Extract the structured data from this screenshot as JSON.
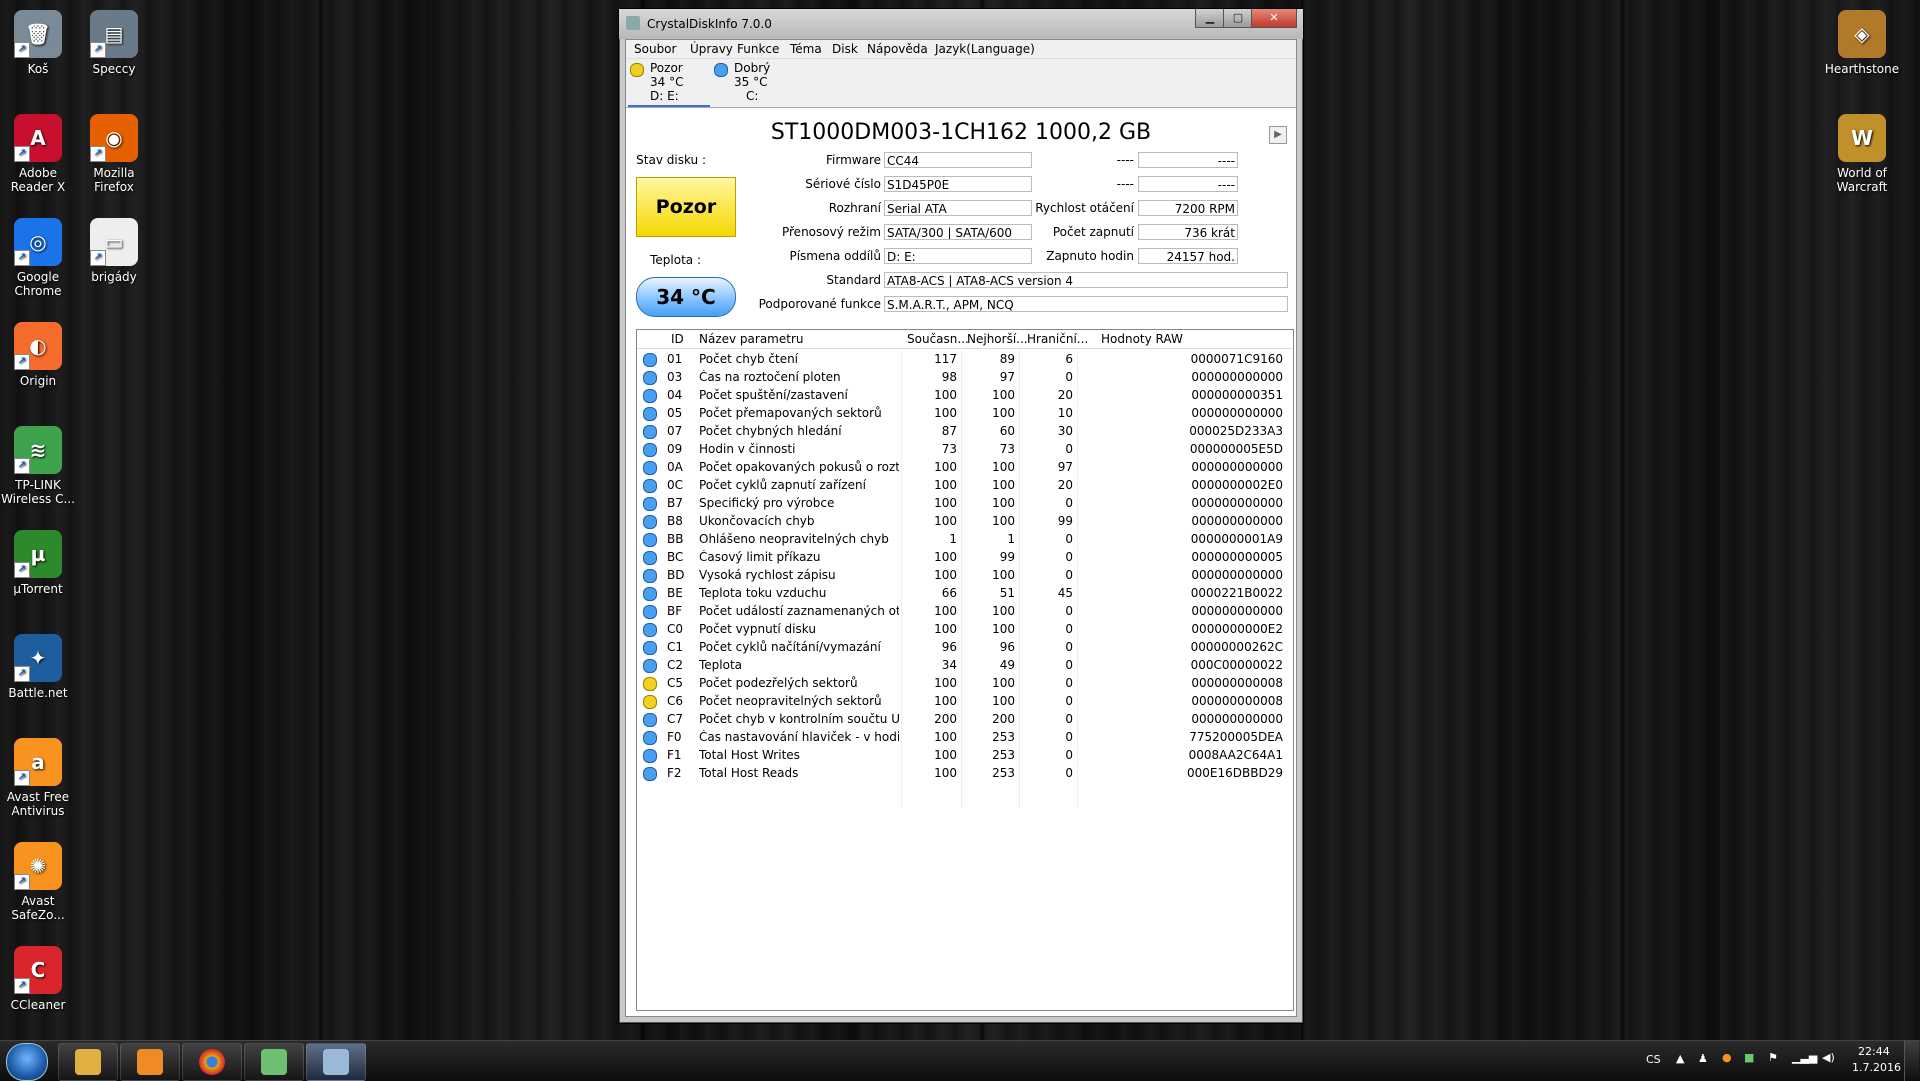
{
  "desktop_left": [
    {
      "label": "Koš",
      "color": "#7a8a96",
      "glyph": "🗑",
      "name": "recycle-bin-icon"
    },
    {
      "label": "Speccy",
      "color": "#6b7a88",
      "glyph": "▤",
      "name": "speccy-icon"
    },
    {
      "label": "Adobe\nReader X",
      "color": "#c8102e",
      "glyph": "A",
      "name": "adobe-reader-icon"
    },
    {
      "label": "Mozilla\nFirefox",
      "color": "#e66000",
      "glyph": "◉",
      "name": "firefox-icon"
    },
    {
      "label": "Google\nChrome",
      "color": "#1a73e8",
      "glyph": "◎",
      "name": "chrome-icon"
    },
    {
      "label": "brigády",
      "color": "#eeeeee",
      "glyph": "▭",
      "name": "document-icon"
    },
    {
      "label": "Origin",
      "color": "#f56c2d",
      "glyph": "◐",
      "name": "origin-icon"
    },
    {
      "label": "TP-LINK\nWireless C...",
      "color": "#3fa34d",
      "glyph": "≋",
      "name": "tplink-icon"
    },
    {
      "label": "µTorrent",
      "color": "#2c8a2c",
      "glyph": "µ",
      "name": "utorrent-icon"
    },
    {
      "label": "Battle.net",
      "color": "#1f5e9e",
      "glyph": "✦",
      "name": "battlenet-icon"
    },
    {
      "label": "Avast Free\nAntivirus",
      "color": "#f7931e",
      "glyph": "a",
      "name": "avast-icon"
    },
    {
      "label": "Avast\nSafeZo...",
      "color": "#f7931e",
      "glyph": "✺",
      "name": "avast-safezone-icon"
    },
    {
      "label": "CCleaner",
      "color": "#d8262c",
      "glyph": "C",
      "name": "ccleaner-icon"
    }
  ],
  "desktop_right": [
    {
      "label": "Hearthstone",
      "color": "#b07a2a",
      "glyph": "◈",
      "name": "hearthstone-icon"
    },
    {
      "label": "World of\nWarcraft",
      "color": "#c0902a",
      "glyph": "W",
      "name": "wow-icon"
    }
  ],
  "window": {
    "title": "CrystalDiskInfo 7.0.0",
    "menu": [
      "Soubor",
      "Úpravy",
      "Funkce",
      "Téma",
      "Disk",
      "Nápověda",
      "Jazyk(Language)"
    ],
    "disks": [
      {
        "status": "Pozor",
        "temp": "34 °C",
        "letters": "D: E:",
        "color": "#f0d020"
      },
      {
        "status": "Dobrý",
        "temp": "35 °C",
        "letters": "C:",
        "color": "#4aa0ee"
      }
    ],
    "model": "ST1000DM003-1CH162 1000,2 GB",
    "stav_label": "Stav disku :",
    "status_text": "Pozor",
    "teplota_label": "Teplota :",
    "temp_text": "34 °C",
    "fields": {
      "firmware_label": "Firmware",
      "firmware": "CC44",
      "serial_label": "Sériové číslo",
      "serial": "S1D45P0E",
      "iface_label": "Rozhraní",
      "iface": "Serial ATA",
      "mode_label": "Přenosový režim",
      "mode": "SATA/300 | SATA/600",
      "letters_label": "Písmena oddílů",
      "letters": "D: E:",
      "standard_label": "Standard",
      "standard": "ATA8-ACS | ATA8-ACS version 4",
      "features_label": "Podporované funkce",
      "features": "S.M.A.R.T., APM, NCQ",
      "r1_label": "----",
      "r1": "----",
      "r2_label": "----",
      "r2": "----",
      "rpm_label": "Rychlost otáčení",
      "rpm": "7200 RPM",
      "count_label": "Počet zapnutí",
      "count": "736 krát",
      "hours_label": "Zapnuto hodin",
      "hours": "24157 hod."
    },
    "table_headers": [
      "ID",
      "Název parametru",
      "Současn...",
      "Nejhorší...",
      "Hraniční...",
      "Hodnoty RAW"
    ],
    "rows": [
      {
        "id": "01",
        "name": "Počet chyb čtení",
        "cur": "117",
        "worst": "89",
        "thr": "6",
        "raw": "0000071C9160",
        "c": "#4aa0ee"
      },
      {
        "id": "03",
        "name": "Čas na roztočení ploten",
        "cur": "98",
        "worst": "97",
        "thr": "0",
        "raw": "000000000000",
        "c": "#4aa0ee"
      },
      {
        "id": "04",
        "name": "Počet spuštění/zastavení",
        "cur": "100",
        "worst": "100",
        "thr": "20",
        "raw": "000000000351",
        "c": "#4aa0ee"
      },
      {
        "id": "05",
        "name": "Počet přemapovaných sektorů",
        "cur": "100",
        "worst": "100",
        "thr": "10",
        "raw": "000000000000",
        "c": "#4aa0ee"
      },
      {
        "id": "07",
        "name": "Počet chybných hledání",
        "cur": "87",
        "worst": "60",
        "thr": "30",
        "raw": "000025D233A3",
        "c": "#4aa0ee"
      },
      {
        "id": "09",
        "name": "Hodin v činnosti",
        "cur": "73",
        "worst": "73",
        "thr": "0",
        "raw": "000000005E5D",
        "c": "#4aa0ee"
      },
      {
        "id": "0A",
        "name": "Počet opakovaných pokusů o roztočení p...",
        "cur": "100",
        "worst": "100",
        "thr": "97",
        "raw": "000000000000",
        "c": "#4aa0ee"
      },
      {
        "id": "0C",
        "name": "Počet cyklů zapnutí zařízení",
        "cur": "100",
        "worst": "100",
        "thr": "20",
        "raw": "0000000002E0",
        "c": "#4aa0ee"
      },
      {
        "id": "B7",
        "name": "Specifický pro výrobce",
        "cur": "100",
        "worst": "100",
        "thr": "0",
        "raw": "000000000000",
        "c": "#4aa0ee"
      },
      {
        "id": "B8",
        "name": "Ukončovacích chyb",
        "cur": "100",
        "worst": "100",
        "thr": "99",
        "raw": "000000000000",
        "c": "#4aa0ee"
      },
      {
        "id": "BB",
        "name": "Ohlášeno neopravitelných chyb",
        "cur": "1",
        "worst": "1",
        "thr": "0",
        "raw": "0000000001A9",
        "c": "#4aa0ee"
      },
      {
        "id": "BC",
        "name": "Časový limit příkazu",
        "cur": "100",
        "worst": "99",
        "thr": "0",
        "raw": "000000000005",
        "c": "#4aa0ee"
      },
      {
        "id": "BD",
        "name": "Vysoká rychlost zápisu",
        "cur": "100",
        "worst": "100",
        "thr": "0",
        "raw": "000000000000",
        "c": "#4aa0ee"
      },
      {
        "id": "BE",
        "name": "Teplota toku vzduchu",
        "cur": "66",
        "worst": "51",
        "thr": "45",
        "raw": "0000221B0022",
        "c": "#4aa0ee"
      },
      {
        "id": "BF",
        "name": "Počet událostí zaznamenaných otřesový...",
        "cur": "100",
        "worst": "100",
        "thr": "0",
        "raw": "000000000000",
        "c": "#4aa0ee"
      },
      {
        "id": "C0",
        "name": "Počet vypnutí disku",
        "cur": "100",
        "worst": "100",
        "thr": "0",
        "raw": "0000000000E2",
        "c": "#4aa0ee"
      },
      {
        "id": "C1",
        "name": "Počet cyklů načítání/vymazání",
        "cur": "96",
        "worst": "96",
        "thr": "0",
        "raw": "00000000262C",
        "c": "#4aa0ee"
      },
      {
        "id": "C2",
        "name": "Teplota",
        "cur": "34",
        "worst": "49",
        "thr": "0",
        "raw": "000C00000022",
        "c": "#4aa0ee"
      },
      {
        "id": "C5",
        "name": "Počet podezřelých sektorů",
        "cur": "100",
        "worst": "100",
        "thr": "0",
        "raw": "000000000008",
        "c": "#f0d020"
      },
      {
        "id": "C6",
        "name": "Počet neopravitelných sektorů",
        "cur": "100",
        "worst": "100",
        "thr": "0",
        "raw": "000000000008",
        "c": "#f0d020"
      },
      {
        "id": "C7",
        "name": "Počet chyb v kontrolním součtu UltraDMA",
        "cur": "200",
        "worst": "200",
        "thr": "0",
        "raw": "000000000000",
        "c": "#4aa0ee"
      },
      {
        "id": "F0",
        "name": "Čas nastavování hlaviček - v hodinách",
        "cur": "100",
        "worst": "253",
        "thr": "0",
        "raw": "775200005DEA",
        "c": "#4aa0ee"
      },
      {
        "id": "F1",
        "name": "Total Host Writes",
        "cur": "100",
        "worst": "253",
        "thr": "0",
        "raw": "0008AA2C64A1",
        "c": "#4aa0ee"
      },
      {
        "id": "F2",
        "name": "Total Host Reads",
        "cur": "100",
        "worst": "253",
        "thr": "0",
        "raw": "000E16DBBD29",
        "c": "#4aa0ee"
      }
    ]
  },
  "taskbar": {
    "lang": "CS",
    "time": "22:44",
    "date": "1.7.2016"
  }
}
